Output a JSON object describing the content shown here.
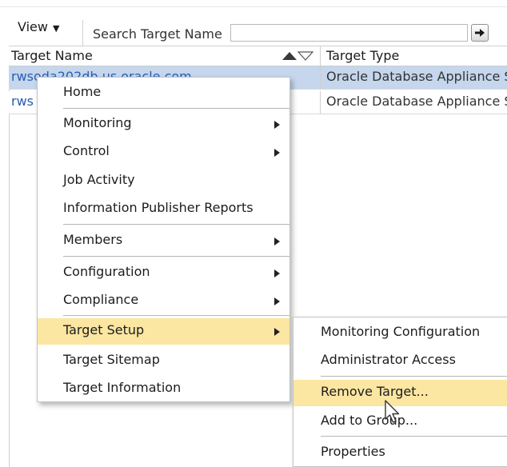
{
  "toolbar": {
    "view_label": "View",
    "search_label": "Search Target Name",
    "search_value": "",
    "search_placeholder": ""
  },
  "table": {
    "columns": [
      "Target Name",
      "Target Type"
    ],
    "rows": [
      {
        "name": "rwsoda202db.us.oracle.com",
        "type": "Oracle Database Appliance S",
        "selected": true
      },
      {
        "name": "rws",
        "type": "Oracle Database Appliance S",
        "selected": false
      }
    ]
  },
  "context_menu": {
    "items": [
      {
        "label": "Home",
        "submenu": false
      },
      {
        "label": "Monitoring",
        "submenu": true
      },
      {
        "label": "Control",
        "submenu": true
      },
      {
        "label": "Job Activity",
        "submenu": false
      },
      {
        "label": "Information Publisher Reports",
        "submenu": false
      },
      {
        "label": "Members",
        "submenu": true
      },
      {
        "label": "Configuration",
        "submenu": true
      },
      {
        "label": "Compliance",
        "submenu": true
      },
      {
        "label": "Target Setup",
        "submenu": true,
        "highlighted": true
      },
      {
        "label": "Target Sitemap",
        "submenu": false
      },
      {
        "label": "Target Information",
        "submenu": false
      }
    ]
  },
  "submenu": {
    "parent": "Target Setup",
    "items": [
      {
        "label": "Monitoring Configuration"
      },
      {
        "label": "Administrator Access"
      },
      {
        "label": "Remove Target...",
        "highlighted": true
      },
      {
        "label": "Add to Group..."
      },
      {
        "label": "Properties"
      }
    ]
  },
  "colors": {
    "selected_row": "#c5d6ed",
    "menu_highlight": "#fbe6a2",
    "link": "#2a5db0"
  },
  "icons": {
    "view_dropdown": "triangle-down-icon",
    "go": "arrow-right-icon",
    "sort": "sort-asc-desc-icon",
    "submenu": "chevron-right-icon",
    "cursor": "mouse-pointer-icon"
  }
}
